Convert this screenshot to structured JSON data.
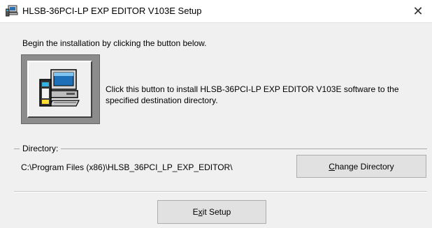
{
  "window": {
    "title": "HLSB-36PCI-LP EXP EDITOR V103E Setup",
    "icon": "setup-computer-icon",
    "close_glyph": "✕"
  },
  "intro_text": "Begin the installation by clicking the button below.",
  "install": {
    "icon": "install-computer-icon",
    "description": "Click this button to install HLSB-36PCI-LP EXP EDITOR V103E software to the specified destination directory."
  },
  "directory": {
    "legend": "Directory:",
    "path": "C:\\Program Files (x86)\\HLSB_36PCI_LP_EXP_EDITOR\\"
  },
  "buttons": {
    "change_directory": {
      "mnemonic": "C",
      "rest": "hange Directory"
    },
    "exit_setup": {
      "pre": "E",
      "mnemonic": "x",
      "rest": "it Setup"
    }
  }
}
